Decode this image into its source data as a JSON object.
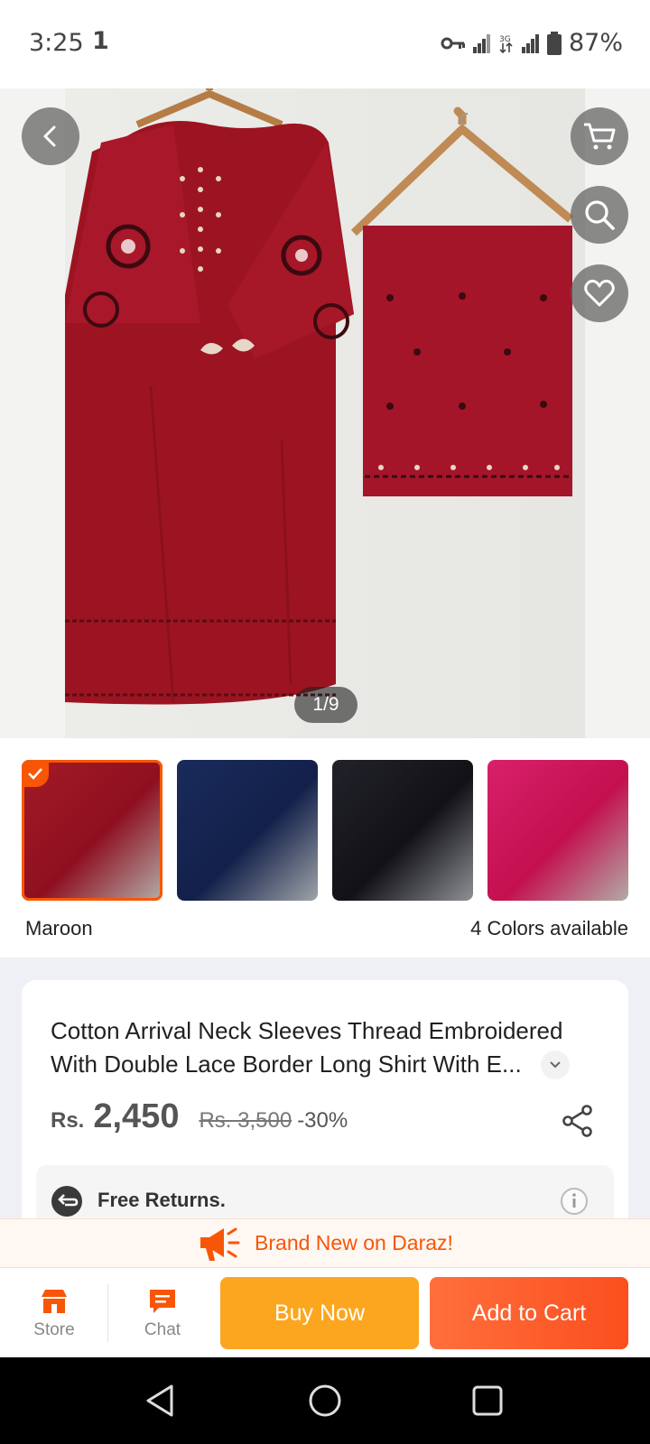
{
  "status_bar": {
    "time": "3:25",
    "notification": "1",
    "network": "3G",
    "battery": "87%"
  },
  "gallery": {
    "pager": "1/9",
    "current_image": "maroon embroidered long shirt with trousers on hanger"
  },
  "variants": {
    "selected_color": "Maroon",
    "available": "4 Colors available",
    "swatches": [
      {
        "name": "Maroon",
        "color": "#9b1422",
        "selected": true
      },
      {
        "name": "Navy",
        "color": "#14214b",
        "selected": false
      },
      {
        "name": "Black",
        "color": "#15151c",
        "selected": false
      },
      {
        "name": "Pink",
        "color": "#d1135e",
        "selected": false
      }
    ]
  },
  "product": {
    "title": "Cotton Arrival Neck Sleeves Thread Embroidered With Double Lace Border Long Shirt With E...",
    "currency": "Rs.",
    "price": "2,450",
    "original_price": "Rs. 3,500",
    "discount": "-30%",
    "returns": "Free Returns."
  },
  "banner": {
    "text": "Brand New on Daraz!"
  },
  "actions": {
    "store": "Store",
    "chat": "Chat",
    "buy_now": "Buy Now",
    "add_to_cart": "Add to Cart"
  },
  "theme": {
    "accent": "#f85606",
    "buy_now": "#fca61f"
  }
}
